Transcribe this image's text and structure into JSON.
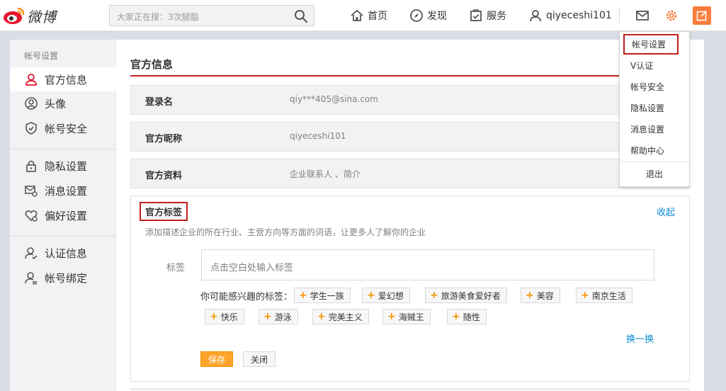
{
  "header": {
    "logo_text": "微博",
    "search_placeholder": "大家正在搜：3次腿脂",
    "nav": [
      {
        "label": "首页",
        "icon": "home-icon"
      },
      {
        "label": "发现",
        "icon": "compass-icon"
      },
      {
        "label": "服务",
        "icon": "service-icon"
      },
      {
        "label": "qiyeceshi101",
        "icon": "user-icon"
      }
    ],
    "icons": [
      "mail-icon",
      "gear-icon",
      "compose-icon"
    ],
    "accent": "#fa7d3c"
  },
  "sidebar": {
    "title": "帐号设置",
    "groups": [
      [
        {
          "label": "官方信息",
          "icon": "user-icon",
          "active": true
        },
        {
          "label": "头像",
          "icon": "avatar-icon"
        },
        {
          "label": "帐号安全",
          "icon": "shield-icon"
        }
      ],
      [
        {
          "label": "隐私设置",
          "icon": "lock-icon"
        },
        {
          "label": "消息设置",
          "icon": "message-settings-icon"
        },
        {
          "label": "偏好设置",
          "icon": "heart-settings-icon"
        }
      ],
      [
        {
          "label": "认证信息",
          "icon": "verify-user-icon"
        },
        {
          "label": "帐号绑定",
          "icon": "bind-user-icon"
        }
      ]
    ]
  },
  "main": {
    "title": "官方信息",
    "rows": [
      {
        "label": "登录名",
        "value": "qiy***405@sina.com"
      },
      {
        "label": "官方昵称",
        "value": "qiyeceshi101"
      },
      {
        "label": "官方资料",
        "value": "企业联系人 、简介"
      }
    ],
    "tags": {
      "title": "官方标签",
      "collapse": "收起",
      "description": "添加描述企业的所在行业、主营方向等方面的词语，让更多人了解你的企业",
      "input_label": "标签",
      "input_placeholder": "点击空白处输入标签",
      "suggest_label": "你可能感兴趣的标签：",
      "suggestions": [
        "学生一族",
        "爱幻想",
        "旅游美食爱好者",
        "美容",
        "南京生活",
        "快乐",
        "游泳",
        "完美主义",
        "海贼王",
        "随性"
      ],
      "refresh": "换一换",
      "save": "保存",
      "close": "关闭"
    }
  },
  "dropdown": {
    "items": [
      "帐号设置",
      "V认证",
      "帐号安全",
      "隐私设置",
      "消息设置",
      "帮助中心"
    ],
    "logout": "退出",
    "highlight_color": "#c01f1f"
  }
}
